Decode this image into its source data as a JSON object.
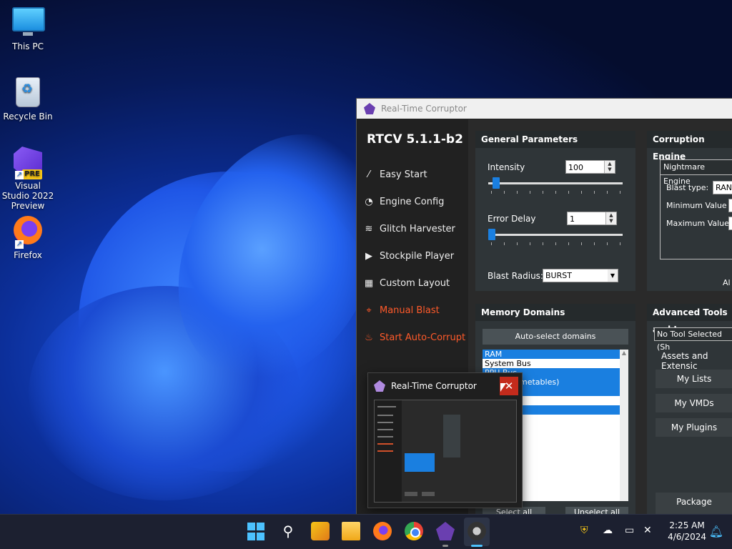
{
  "desktop": {
    "icons": [
      {
        "label": "This PC",
        "icon": "monitor-icon"
      },
      {
        "label": "Recycle Bin",
        "icon": "recycle-bin-icon"
      },
      {
        "label": "Visual Studio 2022 Preview",
        "icon": "visual-studio-icon",
        "badge": "PRE"
      },
      {
        "label": "Firefox",
        "icon": "firefox-icon"
      }
    ]
  },
  "rtc": {
    "title": "Real-Time Corruptor",
    "version": "RTCV 5.1.1-b2",
    "nav": [
      {
        "label": "Easy Start",
        "icon": "wand-icon"
      },
      {
        "label": "Engine Config",
        "icon": "gauge-icon"
      },
      {
        "label": "Glitch Harvester",
        "icon": "layers-icon"
      },
      {
        "label": "Stockpile Player",
        "icon": "play-icon"
      },
      {
        "label": "Custom Layout",
        "icon": "grid-icon"
      },
      {
        "label": "Manual Blast",
        "icon": "crosshair-icon"
      },
      {
        "label": "Start Auto-Corrupt",
        "icon": "flame-icon"
      }
    ],
    "general": {
      "header": "General Parameters",
      "intensity_label": "Intensity",
      "intensity_value": "100",
      "error_delay_label": "Error Delay",
      "error_delay_value": "1",
      "blast_radius_label": "Blast Radius:",
      "blast_radius_value": "BURST"
    },
    "engine": {
      "header": "Corruption Engine",
      "selected": "Nightmare Engine",
      "blast_type_label": "Blast type:",
      "blast_type_value": "RAN",
      "min_label": "Minimum Value",
      "max_label": "Maximum Value",
      "footer": "Al"
    },
    "memory": {
      "header": "Memory Domains",
      "auto_select": "Auto-select domains",
      "domains": [
        {
          "name": "RAM",
          "selected": true
        },
        {
          "name": "System Bus",
          "selected": false
        },
        {
          "name": "PPU Bus",
          "selected": true
        },
        {
          "name": "metables)",
          "selected": true
        },
        {
          "name": "",
          "selected": true
        },
        {
          "name": "M",
          "selected": false
        },
        {
          "name": "",
          "selected": true
        }
      ],
      "select_all": "Select all",
      "unselect_all": "Unselect all"
    },
    "advanced": {
      "header": "Advanced Tools and I",
      "tool_selected": "No Tool Selected (Sh",
      "assets_label": "Assets and Extensic",
      "buttons": [
        "My Lists",
        "My VMDs",
        "My Plugins"
      ],
      "package": "Package Download"
    }
  },
  "preview": {
    "title": "Real-Time Corruptor",
    "close_glyph": "✕"
  },
  "taskbar": {
    "clock_time": "2:25 AM",
    "clock_date": "4/6/2024"
  }
}
